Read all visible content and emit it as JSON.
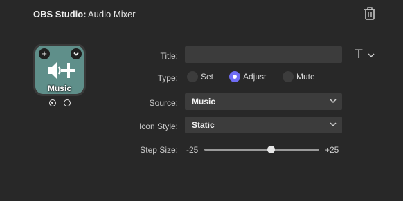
{
  "header": {
    "plugin_name": "OBS Studio:",
    "action_name": "Audio Mixer",
    "delete_icon": "trash-icon"
  },
  "key_tile": {
    "title": "Music",
    "icon": "volume-up-icon",
    "background_color": "#5f8f8a",
    "add_icon": "plus-icon",
    "menu_icon": "chevron-down-icon",
    "states": [
      {
        "selected": true
      },
      {
        "selected": false
      }
    ]
  },
  "form": {
    "title": {
      "label": "Title:",
      "value": "",
      "font_button_label": "T"
    },
    "type": {
      "label": "Type:",
      "options": [
        "Set",
        "Adjust",
        "Mute"
      ],
      "selected": "Adjust"
    },
    "source": {
      "label": "Source:",
      "value": "Music"
    },
    "icon_style": {
      "label": "Icon Style:",
      "value": "Static"
    },
    "step_size": {
      "label": "Step Size:",
      "min_label": "-25",
      "max_label": "+25",
      "min": -25,
      "max": 25,
      "value": 4
    }
  },
  "colors": {
    "accent": "#6f6df5",
    "background": "#282828",
    "field": "#3c3c3c"
  }
}
